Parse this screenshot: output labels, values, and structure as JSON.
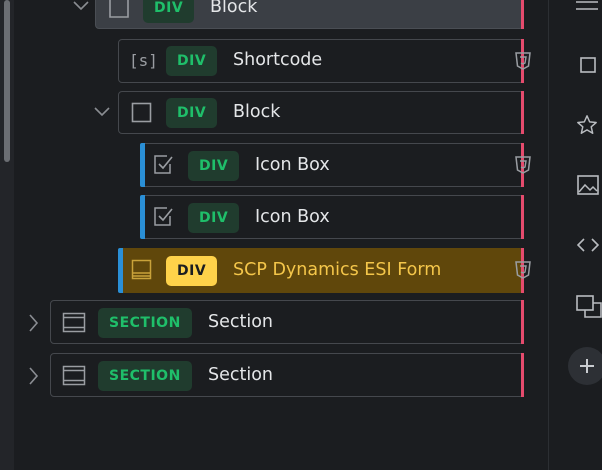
{
  "tree": {
    "rows": [
      {
        "tag": "DIV",
        "label": "Block"
      },
      {
        "tag": "DIV",
        "label": "Shortcode",
        "icon_text": "[s]"
      },
      {
        "tag": "DIV",
        "label": "Block"
      },
      {
        "tag": "DIV",
        "label": "Icon Box"
      },
      {
        "tag": "DIV",
        "label": "Icon Box"
      },
      {
        "tag": "DIV",
        "label": "SCP Dynamics ESI Form"
      },
      {
        "tag": "SECTION",
        "label": "Section"
      },
      {
        "tag": "SECTION",
        "label": "Section"
      }
    ]
  },
  "colors": {
    "accent_pink": "#e54b6d",
    "accent_blue": "#2a8fd6",
    "badge_green": "#1fbf6a",
    "highlight_yellow": "#ffd24a",
    "highlight_row": "#60470b"
  },
  "rail": {
    "icons": [
      "menu-icon",
      "square-icon",
      "star-icon",
      "image-icon",
      "code-icon",
      "copy-icon",
      "plus-icon"
    ]
  }
}
